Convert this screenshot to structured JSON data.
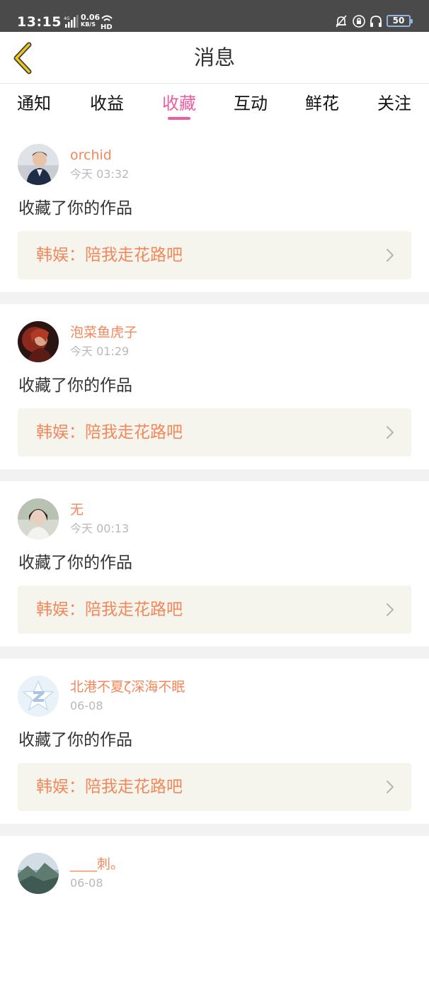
{
  "status_bar": {
    "time": "13:15",
    "network": "4G",
    "speed_value": "0.06",
    "speed_unit": "KB/S",
    "hd_label": "HD",
    "battery": "50"
  },
  "nav": {
    "title": "消息",
    "back_icon": "chevron-left-icon"
  },
  "tabs": [
    {
      "label": "通知",
      "active": false
    },
    {
      "label": "收益",
      "active": false
    },
    {
      "label": "收藏",
      "active": true
    },
    {
      "label": "互动",
      "active": false
    },
    {
      "label": "鲜花",
      "active": false
    },
    {
      "label": "关注",
      "active": false
    }
  ],
  "colors": {
    "accent": "#ee5d9f",
    "username": "#f4875a",
    "work_title": "#f4875a",
    "work_box_bg": "#f5f5ee",
    "separator": "#f2f2f2"
  },
  "messages": [
    {
      "username": "orchid",
      "time": "今天 03:32",
      "action": "收藏了你的作品",
      "work": "韩娱：陪我走花路吧"
    },
    {
      "username": "泡菜鱼虎子",
      "time": "今天 01:29",
      "action": "收藏了你的作品",
      "work": "韩娱：陪我走花路吧"
    },
    {
      "username": "无",
      "time": "今天 00:13",
      "action": "收藏了你的作品",
      "work": "韩娱：陪我走花路吧"
    },
    {
      "username": "北港不夏ζ深海不眠",
      "time": "06-08",
      "action": "收藏了你的作品",
      "work": "韩娱：陪我走花路吧"
    },
    {
      "username": "____刺。",
      "time": "06-08",
      "action": "",
      "work": ""
    }
  ]
}
